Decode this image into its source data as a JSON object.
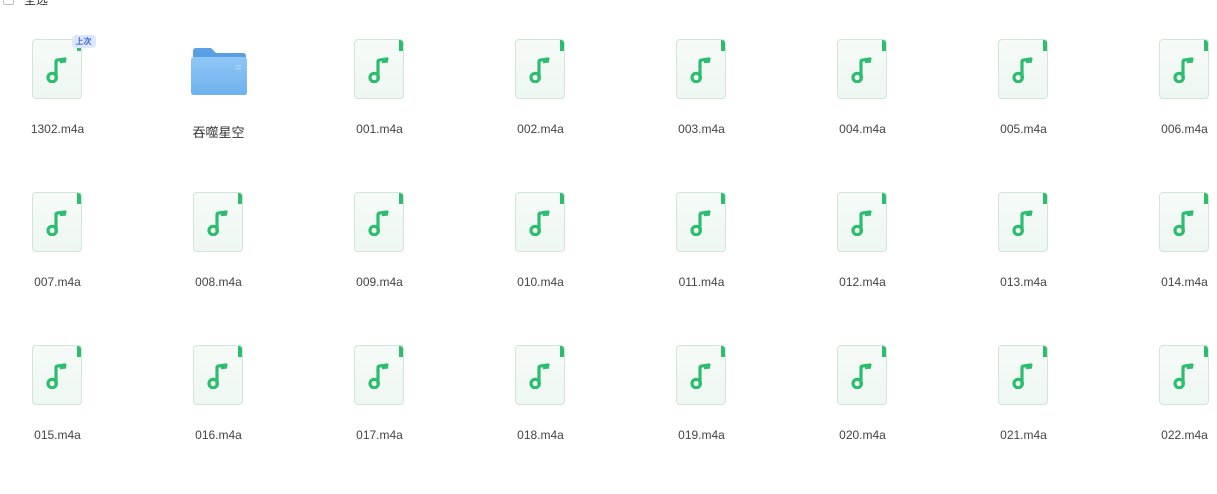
{
  "header": {
    "select_all_label": "全选"
  },
  "items": [
    {
      "name": "1302.m4a",
      "type": "audio",
      "badge": "上次"
    },
    {
      "name": "吞噬星空",
      "type": "folder"
    },
    {
      "name": "001.m4a",
      "type": "audio"
    },
    {
      "name": "002.m4a",
      "type": "audio"
    },
    {
      "name": "003.m4a",
      "type": "audio"
    },
    {
      "name": "004.m4a",
      "type": "audio"
    },
    {
      "name": "005.m4a",
      "type": "audio"
    },
    {
      "name": "006.m4a",
      "type": "audio"
    },
    {
      "name": "007.m4a",
      "type": "audio"
    },
    {
      "name": "008.m4a",
      "type": "audio"
    },
    {
      "name": "009.m4a",
      "type": "audio"
    },
    {
      "name": "010.m4a",
      "type": "audio"
    },
    {
      "name": "011.m4a",
      "type": "audio"
    },
    {
      "name": "012.m4a",
      "type": "audio"
    },
    {
      "name": "013.m4a",
      "type": "audio"
    },
    {
      "name": "014.m4a",
      "type": "audio"
    },
    {
      "name": "015.m4a",
      "type": "audio"
    },
    {
      "name": "016.m4a",
      "type": "audio"
    },
    {
      "name": "017.m4a",
      "type": "audio"
    },
    {
      "name": "018.m4a",
      "type": "audio"
    },
    {
      "name": "019.m4a",
      "type": "audio"
    },
    {
      "name": "020.m4a",
      "type": "audio"
    },
    {
      "name": "021.m4a",
      "type": "audio"
    },
    {
      "name": "022.m4a",
      "type": "audio"
    }
  ],
  "colors": {
    "audio_accent": "#2dbd6e",
    "folder_blue": "#6fb1ee",
    "badge_bg": "#dde7ff",
    "badge_text": "#3f63d8"
  },
  "icons": {
    "audio": "music-note-icon",
    "folder": "folder-icon",
    "checkbox": "checkbox-icon"
  }
}
